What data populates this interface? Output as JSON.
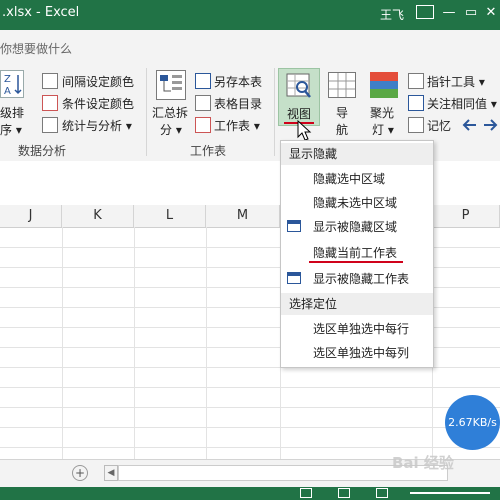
{
  "window": {
    "title": ".xlsx - Excel",
    "user": "王飞",
    "controls": [
      "—",
      "▭",
      "✕"
    ]
  },
  "tell_me": {
    "text": "你想要做什么"
  },
  "ribbon": {
    "group_data_analysis": {
      "big_button_lines": [
        "级排",
        "序 ▾"
      ],
      "items": [
        "间隔设定颜色",
        "条件设定颜色",
        "统计与分析 ▾"
      ],
      "label": "数据分析"
    },
    "group_worksheet": {
      "summary_lines": [
        "汇总拆",
        "分 ▾"
      ],
      "items": [
        "另存本表",
        "表格目录",
        "工作表 ▾"
      ],
      "label": "工作表"
    },
    "view_button": "视图",
    "nav_button_lines": [
      "导",
      "航"
    ],
    "spotlight_button_lines": [
      "聚光",
      "灯 ▾"
    ],
    "right_items": [
      "指针工具 ▾",
      "关注相同值 ▾",
      "记忆"
    ],
    "az_label": "Z\nA"
  },
  "columns": [
    "J",
    "K",
    "L",
    "M",
    "P"
  ],
  "menu": {
    "section1": "显示隐藏",
    "items1": [
      "隐藏选中区域",
      "隐藏未选中区域",
      "显示被隐藏区域",
      "隐藏当前工作表",
      "显示被隐藏工作表"
    ],
    "section2": "选择定位",
    "items2": [
      "选区单独选中每行",
      "选区单独选中每列"
    ]
  },
  "overlay": {
    "speed": "2.67KB/s",
    "watermark": "Bai 经验"
  },
  "colors": {
    "excel_green": "#217346",
    "ribbon_bg": "#f3f3f3",
    "underline_red": "#d0021b",
    "badge_blue": "#2f7fd8"
  }
}
